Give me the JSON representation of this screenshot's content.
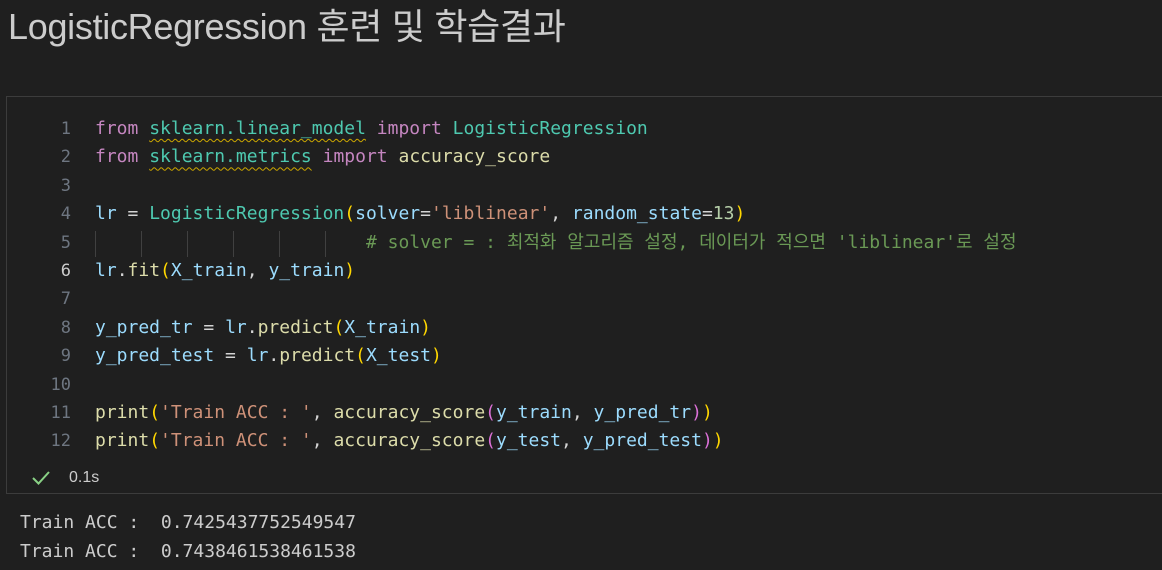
{
  "markdown": {
    "title": "LogisticRegression 훈련 및 학습결과"
  },
  "cell": {
    "lines": [
      {
        "number": "1",
        "tokens": [
          {
            "text": "from",
            "cls": "kw"
          },
          {
            "text": " ",
            "cls": "op"
          },
          {
            "text": "sklearn.linear_model",
            "cls": "cls squig"
          },
          {
            "text": " ",
            "cls": "op"
          },
          {
            "text": "import",
            "cls": "kw"
          },
          {
            "text": " ",
            "cls": "op"
          },
          {
            "text": "LogisticRegression",
            "cls": "cls"
          }
        ]
      },
      {
        "number": "2",
        "tokens": [
          {
            "text": "from",
            "cls": "kw"
          },
          {
            "text": " ",
            "cls": "op"
          },
          {
            "text": "sklearn.metrics",
            "cls": "cls squig"
          },
          {
            "text": " ",
            "cls": "op"
          },
          {
            "text": "import",
            "cls": "kw"
          },
          {
            "text": " ",
            "cls": "op"
          },
          {
            "text": "accuracy_score",
            "cls": "fn"
          }
        ]
      },
      {
        "number": "3",
        "tokens": []
      },
      {
        "number": "4",
        "tokens": [
          {
            "text": "lr",
            "cls": "var"
          },
          {
            "text": " = ",
            "cls": "op"
          },
          {
            "text": "LogisticRegression",
            "cls": "cls"
          },
          {
            "text": "(",
            "cls": "p1"
          },
          {
            "text": "solver",
            "cls": "var"
          },
          {
            "text": "=",
            "cls": "op"
          },
          {
            "text": "'liblinear'",
            "cls": "str"
          },
          {
            "text": ", ",
            "cls": "op"
          },
          {
            "text": "random_state",
            "cls": "var"
          },
          {
            "text": "=",
            "cls": "op"
          },
          {
            "text": "13",
            "cls": "num"
          },
          {
            "text": ")",
            "cls": "p1"
          }
        ]
      },
      {
        "number": "5",
        "tokens": [
          {
            "text": "                         ",
            "cls": "op"
          },
          {
            "text": "# solver = : 최적화 알고리즘 설정, 데이터가 적으면 'liblinear'로 설정",
            "cls": "cm"
          }
        ]
      },
      {
        "number": "6",
        "active": true,
        "tokens": [
          {
            "text": "lr",
            "cls": "var"
          },
          {
            "text": ".",
            "cls": "op"
          },
          {
            "text": "fit",
            "cls": "fn"
          },
          {
            "text": "(",
            "cls": "p1"
          },
          {
            "text": "X_train",
            "cls": "var"
          },
          {
            "text": ", ",
            "cls": "op"
          },
          {
            "text": "y_train",
            "cls": "var"
          },
          {
            "text": ")",
            "cls": "p1"
          }
        ]
      },
      {
        "number": "7",
        "tokens": []
      },
      {
        "number": "8",
        "tokens": [
          {
            "text": "y_pred_tr",
            "cls": "var"
          },
          {
            "text": " = ",
            "cls": "op"
          },
          {
            "text": "lr",
            "cls": "var"
          },
          {
            "text": ".",
            "cls": "op"
          },
          {
            "text": "predict",
            "cls": "fn"
          },
          {
            "text": "(",
            "cls": "p1"
          },
          {
            "text": "X_train",
            "cls": "var"
          },
          {
            "text": ")",
            "cls": "p1"
          }
        ]
      },
      {
        "number": "9",
        "tokens": [
          {
            "text": "y_pred_test",
            "cls": "var"
          },
          {
            "text": " = ",
            "cls": "op"
          },
          {
            "text": "lr",
            "cls": "var"
          },
          {
            "text": ".",
            "cls": "op"
          },
          {
            "text": "predict",
            "cls": "fn"
          },
          {
            "text": "(",
            "cls": "p1"
          },
          {
            "text": "X_test",
            "cls": "var"
          },
          {
            "text": ")",
            "cls": "p1"
          }
        ]
      },
      {
        "number": "10",
        "tokens": []
      },
      {
        "number": "11",
        "tokens": [
          {
            "text": "print",
            "cls": "fn"
          },
          {
            "text": "(",
            "cls": "p1"
          },
          {
            "text": "'Train ACC : '",
            "cls": "str"
          },
          {
            "text": ", ",
            "cls": "op"
          },
          {
            "text": "accuracy_score",
            "cls": "fn"
          },
          {
            "text": "(",
            "cls": "p2"
          },
          {
            "text": "y_train",
            "cls": "var"
          },
          {
            "text": ", ",
            "cls": "op"
          },
          {
            "text": "y_pred_tr",
            "cls": "var"
          },
          {
            "text": ")",
            "cls": "p2"
          },
          {
            "text": ")",
            "cls": "p1"
          }
        ]
      },
      {
        "number": "12",
        "tokens": [
          {
            "text": "print",
            "cls": "fn"
          },
          {
            "text": "(",
            "cls": "p1"
          },
          {
            "text": "'Train ACC : '",
            "cls": "str"
          },
          {
            "text": ", ",
            "cls": "op"
          },
          {
            "text": "accuracy_score",
            "cls": "fn"
          },
          {
            "text": "(",
            "cls": "p2"
          },
          {
            "text": "y_test",
            "cls": "var"
          },
          {
            "text": ", ",
            "cls": "op"
          },
          {
            "text": "y_pred_test",
            "cls": "var"
          },
          {
            "text": ")",
            "cls": "p2"
          },
          {
            "text": ")",
            "cls": "p1"
          }
        ]
      }
    ],
    "status": {
      "icon": "checkmark-icon",
      "icon_color": "#89d185",
      "exec_time": "0.1s"
    }
  },
  "output": {
    "lines": [
      "Train ACC :  0.7425437752549547",
      "Train ACC :  0.7438461538461538"
    ]
  },
  "colors": {
    "background": "#1f1f1f",
    "keyword": "#c586c0",
    "class": "#4ec9b0",
    "function": "#dcdcaa",
    "variable": "#9cdcfe",
    "string": "#ce9178",
    "number": "#b5cea8",
    "comment": "#6a9955"
  }
}
